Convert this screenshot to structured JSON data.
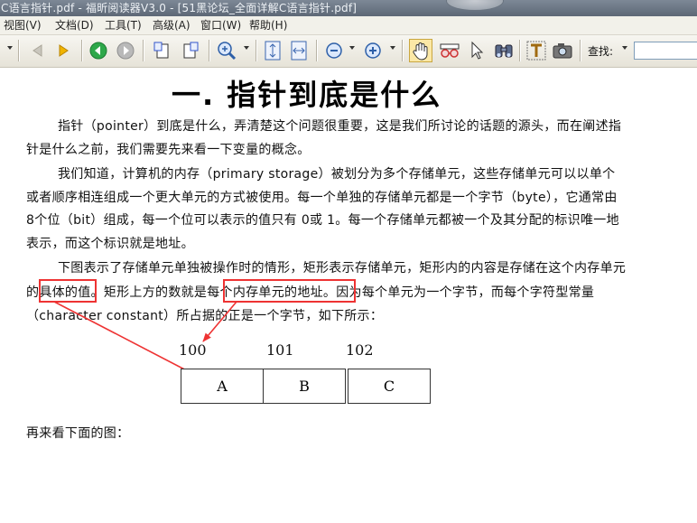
{
  "window": {
    "title": "C语言指针.pdf - 福昕阅读器V3.0 - [51黑论坛_全面详解C语言指针.pdf]"
  },
  "menu": [
    "视图(V)",
    "文档(D)",
    "工具(T)",
    "高级(A)",
    "窗口(W)",
    "帮助(H)"
  ],
  "toolbar": {
    "search_label": "查找:",
    "search_value": ""
  },
  "doc": {
    "heading": "一. 指针到底是什么",
    "p1": [
      "指针（pointer）到底是什么，弄清楚这个问题很重要，这是我们所讨论的话题的源头，而在阐述指",
      "针是什么之前，我们需要先来看一下变量的概念。"
    ],
    "p2": [
      "我们知道，计算机的内存（primary storage）被划分为多个存储单元，这些存储单元可以以单个",
      "或者顺序相连组成一个更大单元的方式被使用。每一个单独的存储单元都是一个字节（byte），它通常由",
      "8个位（bit）组成，每一个位可以表示的值只有 0或 1。每一个存储单元都被一个及其分配的标识唯一地",
      "表示，而这个标识就是地址。"
    ],
    "p3_line1": "下图表示了存储单元单独被操作时的情形，矩形表示存储单元，矩形内的内容是存储在这个内存单元",
    "p3_line2_a": "的",
    "p3_line2_b": "具体的值",
    "p3_line2_c": "。矩形上方的数就是",
    "p3_line2_d": "每个内存单元的地址",
    "p3_line2_e": "。因为每个单元为一个字节，而每个字符型常量",
    "p3_line3": "（character constant）所占据的正是一个字节，如下所示：",
    "addresses": [
      "100",
      "101",
      "102"
    ],
    "cells": [
      "A",
      "B",
      "C"
    ],
    "p4": "再来看下面的图："
  },
  "colors": {
    "annotation": "#e33333",
    "titlebar": "#6b7684",
    "toolbar": "#eeece4"
  },
  "icons": [
    "back-icon",
    "forward-icon",
    "nav-prev-icon",
    "nav-next-icon",
    "rotate-left-icon",
    "rotate-right-icon",
    "zoom-in-icon",
    "fit-page-icon",
    "fit-width-icon",
    "zoom-out-icon",
    "zoom-plus-icon",
    "hand-tool-icon",
    "reading-glasses-icon",
    "select-arrow-icon",
    "binoculars-icon",
    "text-tool-icon",
    "snapshot-icon"
  ]
}
